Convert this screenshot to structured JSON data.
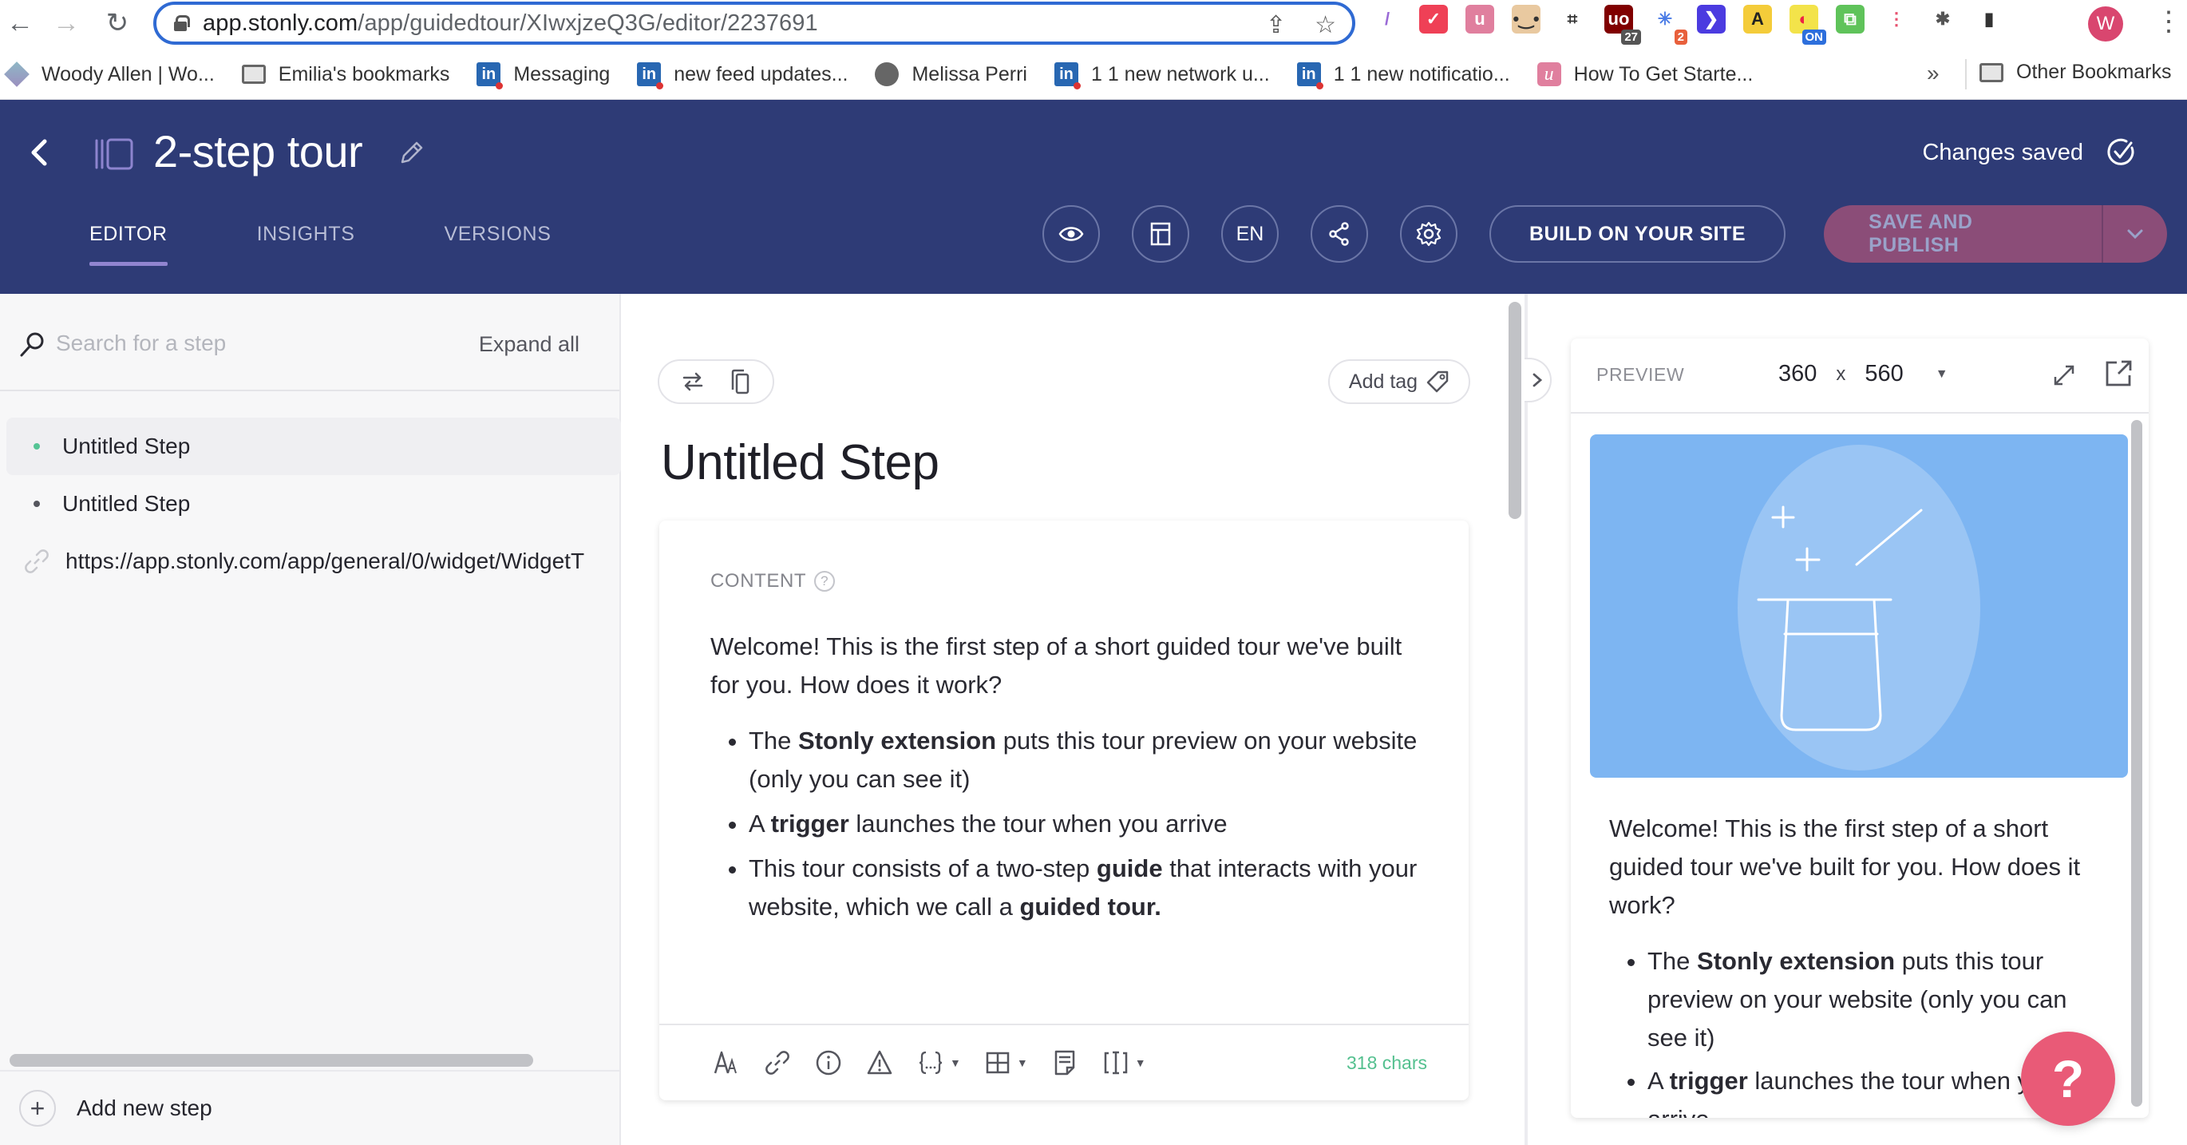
{
  "browser": {
    "url_host": "app.stonly.com",
    "url_path": "/app/guidedtour/XIwxjzeQ3G/editor/2237691",
    "extensions": [
      {
        "name": "quill-extension",
        "glyph": "/",
        "bg": "#ffffff",
        "fg": "#9a6ad6"
      },
      {
        "name": "pocket-extension",
        "glyph": "✓",
        "bg": "#ef4056",
        "fg": "#ffffff"
      },
      {
        "name": "u-extension",
        "glyph": "u",
        "bg": "#e07f9e",
        "fg": "#ffffff"
      },
      {
        "name": "face-extension",
        "glyph": "•‿•",
        "bg": "#e9c9a0",
        "fg": "#333333"
      },
      {
        "name": "screenshot-extension",
        "glyph": "⌗",
        "bg": "#ffffff",
        "fg": "#333333"
      },
      {
        "name": "ublock-extension",
        "glyph": "uo",
        "bg": "#800000",
        "fg": "#ffffff",
        "badge": "27",
        "badge_bg": "#555555"
      },
      {
        "name": "sparkle-extension",
        "glyph": "✳",
        "bg": "#ffffff",
        "fg": "#4a7be6",
        "badge": "2",
        "badge_bg": "#e8603c"
      },
      {
        "name": "arrow-extension",
        "glyph": "❯",
        "bg": "#4b3be0",
        "fg": "#ffffff"
      },
      {
        "name": "font-extension",
        "glyph": "A",
        "bg": "#f4cc3a",
        "fg": "#222222"
      },
      {
        "name": "toggle-extension",
        "glyph": "◐",
        "bg": "#f3e34a",
        "fg": "#e24",
        "badge": "ON",
        "badge_bg": "#2d6fdc"
      },
      {
        "name": "clipboard-extension",
        "glyph": "⧉",
        "bg": "#5fc35a",
        "fg": "#ffffff"
      },
      {
        "name": "stacks-extension",
        "glyph": "⋮",
        "bg": "#ffffff",
        "fg": "#e85370"
      },
      {
        "name": "puzzle-extension",
        "glyph": "✱",
        "bg": "#ffffff",
        "fg": "#555555"
      },
      {
        "name": "sidepanel-extension",
        "glyph": "▮",
        "bg": "#ffffff",
        "fg": "#333333"
      }
    ],
    "profile_initial": "W",
    "bookmarks": [
      {
        "label": "Woody Allen | Wo...",
        "icon": "gem"
      },
      {
        "label": "Emilia's bookmarks",
        "icon": "folder"
      },
      {
        "label": "Messaging",
        "icon": "linkedin"
      },
      {
        "label": "new feed updates...",
        "icon": "linkedin"
      },
      {
        "label": "Melissa Perri",
        "icon": "globe"
      },
      {
        "label": "1 1 new network u...",
        "icon": "linkedin"
      },
      {
        "label": "1 1 new notificatio...",
        "icon": "linkedin"
      },
      {
        "label": "How To Get Starte...",
        "icon": "u"
      }
    ],
    "bookmarks_overflow": "»",
    "other_bookmarks": "Other Bookmarks"
  },
  "header": {
    "title": "2-step tour",
    "status": "Changes saved",
    "tabs": [
      {
        "label": "EDITOR",
        "active": true
      },
      {
        "label": "INSIGHTS",
        "active": false
      },
      {
        "label": "VERSIONS",
        "active": false
      }
    ],
    "language": "EN",
    "build_label": "BUILD ON YOUR SITE",
    "publish_label": "SAVE AND PUBLISH",
    "colors": {
      "header_bg": "#2e3b76",
      "publish_bg": "#8b4d78",
      "tab_indicator": "#9185d0"
    }
  },
  "sidebar": {
    "search_placeholder": "Search for a step",
    "expand_all": "Expand all",
    "steps": [
      {
        "label": "Untitled Step",
        "type": "step",
        "active": true,
        "dot_color": "#55c495"
      },
      {
        "label": "Untitled Step",
        "type": "step",
        "active": false,
        "dot_color": "#55565e"
      },
      {
        "label": "https://app.stonly.com/app/general/0/widget/WidgetT",
        "type": "link",
        "active": false
      }
    ],
    "add_step": "Add new step"
  },
  "editor": {
    "add_tag": "Add tag",
    "step_title": "Untitled Step",
    "content_label": "CONTENT",
    "help_glyph": "?",
    "intro": "Welcome! This is the first step of a short guided tour we've built for you. How does it work?",
    "bullets": [
      {
        "pre": "The ",
        "bold": "Stonly extension",
        "post": " puts this tour preview on your website (only you can see it)"
      },
      {
        "pre": "A ",
        "bold": "trigger",
        "post": " launches the tour when you arrive"
      },
      {
        "pre": "This tour consists of a two-step ",
        "bold": "guide",
        "post": " that interacts with your website, which we call a ",
        "bold2": "guided tour."
      }
    ],
    "char_count": "318 chars"
  },
  "preview": {
    "label": "PREVIEW",
    "width": "360",
    "x": "x",
    "height": "560",
    "hero_color": "#7db5f2",
    "intro": "Welcome! This is the first step of a short guided tour we've built for you. How does it work?",
    "bullets": [
      {
        "pre": "The ",
        "bold": "Stonly extension",
        "post": " puts this tour preview on your website (only you can see it)"
      },
      {
        "pre": "A ",
        "bold": "trigger",
        "post": " launches the tour when you arrive"
      }
    ]
  },
  "help_fab": "?"
}
